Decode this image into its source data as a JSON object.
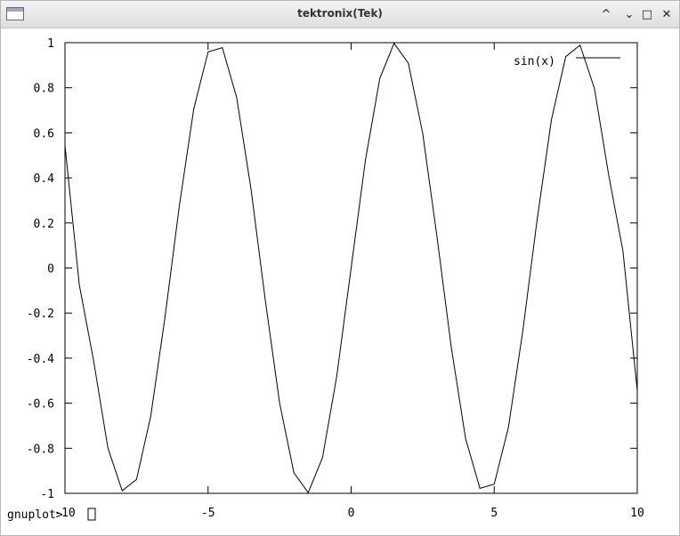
{
  "window": {
    "title": "tektronix(Tek)",
    "controls": {
      "minimize": "^",
      "restore": "⌄",
      "maximize": "□",
      "close": "✕"
    }
  },
  "console": {
    "prompt": "gnuplot>",
    "cursor": ""
  },
  "chart_data": {
    "type": "line",
    "title": "",
    "xlabel": "",
    "ylabel": "",
    "xlim": [
      -10,
      10
    ],
    "ylim": [
      -1,
      1
    ],
    "x_ticks": [
      -10,
      -5,
      0,
      5,
      10
    ],
    "x_tick_labels": [
      "-10",
      "-5",
      "0",
      "5",
      "10"
    ],
    "y_ticks": [
      -1,
      -0.8,
      -0.6,
      -0.4,
      -0.2,
      0,
      0.2,
      0.4,
      0.6,
      0.8,
      1
    ],
    "y_tick_labels": [
      "-1",
      "-0.8",
      "-0.6",
      "-0.4",
      "-0.2",
      "0",
      "0.2",
      "0.4",
      "0.6",
      "0.8",
      "1"
    ],
    "grid": false,
    "legend_position": "top-right",
    "series": [
      {
        "name": "sin(x)",
        "color": "#000000",
        "x": [
          -10,
          -9.5,
          -9,
          -8.5,
          -8,
          -7.5,
          -7,
          -6.5,
          -6,
          -5.5,
          -5,
          -4.5,
          -4,
          -3.5,
          -3,
          -2.5,
          -2,
          -1.5,
          -1,
          -0.5,
          0,
          0.5,
          1,
          1.5,
          2,
          2.5,
          3,
          3.5,
          4,
          4.5,
          5,
          5.5,
          6,
          6.5,
          7,
          7.5,
          8,
          8.5,
          9,
          9.5,
          10
        ],
        "y": [
          0.544,
          -0.075,
          -0.412,
          -0.798,
          -0.989,
          -0.938,
          -0.657,
          -0.215,
          0.279,
          0.706,
          0.959,
          0.978,
          0.757,
          0.351,
          -0.141,
          -0.598,
          -0.909,
          -0.997,
          -0.841,
          -0.479,
          0,
          0.479,
          0.841,
          0.997,
          0.909,
          0.598,
          0.141,
          -0.351,
          -0.757,
          -0.978,
          -0.959,
          -0.706,
          -0.279,
          0.215,
          0.657,
          0.938,
          0.989,
          0.798,
          0.412,
          0.075,
          -0.544
        ]
      }
    ]
  }
}
